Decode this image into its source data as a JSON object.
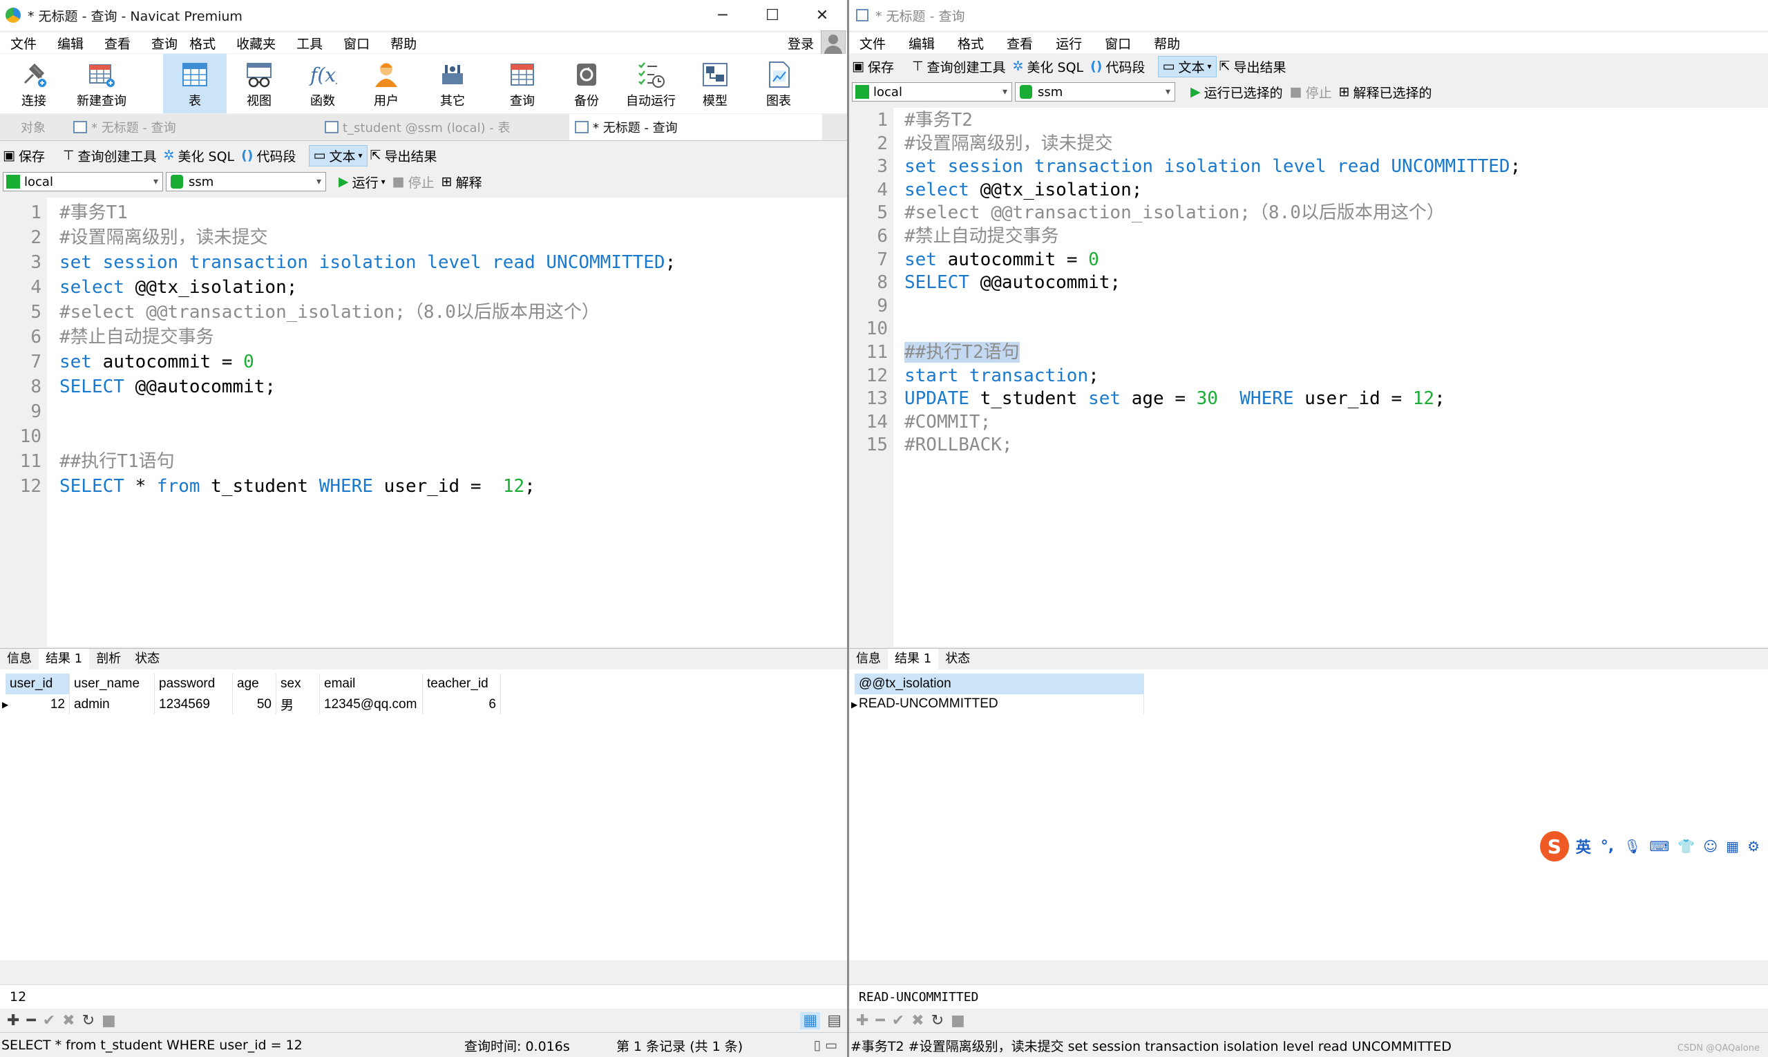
{
  "left": {
    "title": "* 无标题 - 查询 - Navicat Premium",
    "menu": [
      "文件",
      "编辑",
      "查看",
      "查询",
      "格式",
      "收藏夹",
      "工具",
      "窗口",
      "帮助"
    ],
    "login": "登录",
    "ribbon": [
      "连接",
      "新建查询",
      "表",
      "视图",
      "函数",
      "用户",
      "其它",
      "查询",
      "备份",
      "自动运行",
      "模型",
      "图表"
    ],
    "tabs": [
      "对象",
      "* 无标题 - 查询",
      "t_student @ssm (local) - 表",
      "* 无标题 - 查询"
    ],
    "toolbar": {
      "save": "保存",
      "builder": "查询创建工具",
      "beautify": "美化 SQL",
      "snippet": "代码段",
      "text": "文本",
      "export": "导出结果"
    },
    "conn": "local",
    "db": "ssm",
    "run": {
      "run": "运行",
      "stop": "停止",
      "explain": "解释"
    },
    "lines": [
      {
        "n": "1",
        "t": [
          {
            "c": "cm",
            "s": "#事务T1"
          }
        ]
      },
      {
        "n": "2",
        "t": [
          {
            "c": "cm",
            "s": "#设置隔离级别，读未提交"
          }
        ]
      },
      {
        "n": "3",
        "t": [
          {
            "c": "kw",
            "s": "set session transaction isolation level read UNCOMMITTED"
          },
          {
            "c": "",
            "s": ";"
          }
        ]
      },
      {
        "n": "4",
        "t": [
          {
            "c": "kw",
            "s": "select"
          },
          {
            "c": "",
            "s": " @@tx_isolation;"
          }
        ]
      },
      {
        "n": "5",
        "t": [
          {
            "c": "cm",
            "s": "#select @@transaction_isolation;（8.0以后版本用这个）"
          }
        ]
      },
      {
        "n": "6",
        "t": [
          {
            "c": "cm",
            "s": "#禁止自动提交事务"
          }
        ]
      },
      {
        "n": "7",
        "t": [
          {
            "c": "kw",
            "s": "set"
          },
          {
            "c": "",
            "s": " autocommit = "
          },
          {
            "c": "num",
            "s": "0"
          }
        ]
      },
      {
        "n": "8",
        "t": [
          {
            "c": "kw",
            "s": "SELECT"
          },
          {
            "c": "",
            "s": " @@autocommit;"
          }
        ]
      },
      {
        "n": "9",
        "t": []
      },
      {
        "n": "10",
        "t": []
      },
      {
        "n": "11",
        "t": [
          {
            "c": "cm",
            "s": "##执行T1语句"
          }
        ]
      },
      {
        "n": "12",
        "t": [
          {
            "c": "kw",
            "s": "SELECT"
          },
          {
            "c": "",
            "s": " * "
          },
          {
            "c": "kw",
            "s": "from"
          },
          {
            "c": "",
            "s": " t_student "
          },
          {
            "c": "kw",
            "s": "WHERE"
          },
          {
            "c": "",
            "s": " user_id =  "
          },
          {
            "c": "num",
            "s": "12"
          },
          {
            "c": "",
            "s": ";"
          }
        ]
      }
    ],
    "result_tabs": [
      "信息",
      "结果 1",
      "剖析",
      "状态"
    ],
    "columns": [
      "user_id",
      "user_name",
      "password",
      "age",
      "sex",
      "email",
      "teacher_id"
    ],
    "rows": [
      [
        "12",
        "admin",
        "1234569",
        "50",
        "男",
        "12345@qq.com",
        "6"
      ]
    ],
    "value": "12",
    "status_sql": "SELECT * from t_student WHERE user_id =  12",
    "status_time": "查询时间: 0.016s",
    "status_rec": "第 1 条记录 (共 1 条)"
  },
  "right": {
    "title": "* 无标题 - 查询",
    "menu": [
      "文件",
      "编辑",
      "格式",
      "查看",
      "运行",
      "窗口",
      "帮助"
    ],
    "toolbar": {
      "save": "保存",
      "builder": "查询创建工具",
      "beautify": "美化 SQL",
      "snippet": "代码段",
      "text": "文本",
      "export": "导出结果"
    },
    "conn": "local",
    "db": "ssm",
    "run": {
      "run": "运行已选择的",
      "stop": "停止",
      "explain": "解释已选择的"
    },
    "lines": [
      {
        "n": "1",
        "t": [
          {
            "c": "cm",
            "s": "#事务T2"
          }
        ]
      },
      {
        "n": "2",
        "t": [
          {
            "c": "cm",
            "s": "#设置隔离级别，读未提交"
          }
        ]
      },
      {
        "n": "3",
        "t": [
          {
            "c": "kw",
            "s": "set session transaction isolation level read UNCOMMITTED"
          },
          {
            "c": "",
            "s": ";"
          }
        ]
      },
      {
        "n": "4",
        "t": [
          {
            "c": "kw",
            "s": "select"
          },
          {
            "c": "",
            "s": " @@tx_isolation;"
          }
        ]
      },
      {
        "n": "5",
        "t": [
          {
            "c": "cm",
            "s": "#select @@transaction_isolation;（8.0以后版本用这个）"
          }
        ]
      },
      {
        "n": "6",
        "t": [
          {
            "c": "cm",
            "s": "#禁止自动提交事务"
          }
        ]
      },
      {
        "n": "7",
        "t": [
          {
            "c": "kw",
            "s": "set"
          },
          {
            "c": "",
            "s": " autocommit = "
          },
          {
            "c": "num",
            "s": "0"
          }
        ]
      },
      {
        "n": "8",
        "t": [
          {
            "c": "kw",
            "s": "SELECT"
          },
          {
            "c": "",
            "s": " @@autocommit;"
          }
        ]
      },
      {
        "n": "9",
        "t": []
      },
      {
        "n": "10",
        "t": []
      },
      {
        "n": "11",
        "t": [
          {
            "c": "cm hl",
            "s": "##执行T2语句"
          }
        ]
      },
      {
        "n": "12",
        "t": [
          {
            "c": "kw",
            "s": "start transaction"
          },
          {
            "c": "",
            "s": ";"
          }
        ]
      },
      {
        "n": "13",
        "t": [
          {
            "c": "kw",
            "s": "UPDATE"
          },
          {
            "c": "",
            "s": " t_student "
          },
          {
            "c": "kw",
            "s": "set"
          },
          {
            "c": "",
            "s": " age = "
          },
          {
            "c": "num",
            "s": "30"
          },
          {
            "c": "",
            "s": "  "
          },
          {
            "c": "kw",
            "s": "WHERE"
          },
          {
            "c": "",
            "s": " user_id = "
          },
          {
            "c": "num",
            "s": "12"
          },
          {
            "c": "",
            "s": ";"
          }
        ]
      },
      {
        "n": "14",
        "t": [
          {
            "c": "cm",
            "s": "#COMMIT;"
          }
        ]
      },
      {
        "n": "15",
        "t": [
          {
            "c": "cm",
            "s": "#ROLLBACK;"
          }
        ]
      }
    ],
    "result_tabs": [
      "信息",
      "结果 1",
      "状态"
    ],
    "columns": [
      "@@tx_isolation"
    ],
    "rows": [
      [
        "READ-UNCOMMITTED"
      ]
    ],
    "value": "READ-UNCOMMITTED",
    "status_sql": "#事务T2 #设置隔离级别，读未提交 set session transaction isolation level read UNCOMMITTED",
    "ime": [
      "英",
      "°,"
    ],
    "watermark": "CSDN @QAQalone"
  },
  "colors": {
    "keyword": "#1979ce",
    "comment": "#8c8c8c",
    "number": "#1aad35",
    "selection": "#cce4f7"
  }
}
